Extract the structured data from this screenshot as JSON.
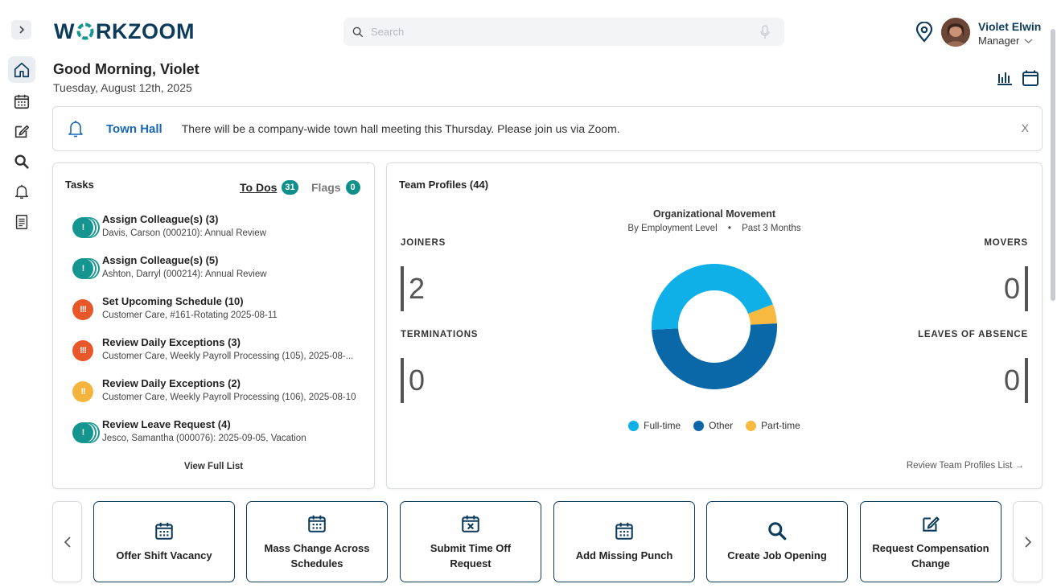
{
  "app": {
    "logo_left": "W",
    "logo_right": "RKZOOM",
    "brand_color": "#0c3b5c",
    "accent_teal": "#14958f"
  },
  "search": {
    "placeholder": "Search"
  },
  "user": {
    "name": "Violet Elwin",
    "role": "Manager"
  },
  "greeting": {
    "title": "Good Morning, Violet",
    "date": "Tuesday, August 12th, 2025"
  },
  "announcement": {
    "title": "Town Hall",
    "message": "There will be a company-wide town hall meeting this Thursday. Please join us via Zoom.",
    "close": "X"
  },
  "tasks": {
    "title": "Tasks",
    "tabs": [
      {
        "label": "To Dos",
        "count": "31"
      },
      {
        "label": "Flags",
        "count": "0"
      }
    ],
    "items": [
      {
        "title": "Assign Colleague(s) (3)",
        "sub": "Davis, Carson (000210): Annual Review",
        "priority": "!",
        "color": "teal"
      },
      {
        "title": "Assign Colleague(s) (5)",
        "sub": "Ashton, Darryl (000214): Annual Review",
        "priority": "!",
        "color": "teal"
      },
      {
        "title": "Set Upcoming Schedule (10)",
        "sub": "Customer Care, #161-Rotating 2025-08-11",
        "priority": "!!!",
        "color": "red"
      },
      {
        "title": "Review Daily Exceptions (3)",
        "sub": "Customer Care, Weekly Payroll Processing (105), 2025-08-...",
        "priority": "!!!",
        "color": "red"
      },
      {
        "title": "Review Daily Exceptions (2)",
        "sub": "Customer Care, Weekly Payroll Processing (106), 2025-08-10",
        "priority": "!!",
        "color": "amber"
      },
      {
        "title": "Review Leave Request (4)",
        "sub": "Jesco, Samantha (000076): 2025-09-05, Vacation",
        "priority": "!",
        "color": "teal"
      }
    ],
    "view_full": "View Full List"
  },
  "team": {
    "title": "Team Profiles (44)",
    "chart_title": "Organizational Movement",
    "chart_sub_a": "By Employment Level",
    "chart_sub_sep": "•",
    "chart_sub_b": "Past 3 Months",
    "stats": {
      "joiners_label": "JOINERS",
      "joiners": "2",
      "terminations_label": "TERMINATIONS",
      "terminations": "0",
      "movers_label": "MOVERS",
      "movers": "0",
      "loa_label": "LEAVES OF ABSENCE",
      "loa": "0"
    },
    "review_link": "Review Team Profiles List →"
  },
  "chart_data": {
    "type": "pie",
    "donut": true,
    "categories": [
      "Full-time",
      "Other",
      "Part-time"
    ],
    "values": [
      45,
      50,
      5
    ],
    "colors": [
      "#0fb0e8",
      "#0a67a8",
      "#f7b940"
    ],
    "title": "Organizational Movement",
    "legend_position": "bottom"
  },
  "quick_actions": [
    {
      "label": "Offer Shift Vacancy",
      "icon": "calendar-icon"
    },
    {
      "label": "Mass Change Across Schedules",
      "icon": "calendar-icon"
    },
    {
      "label": "Submit Time Off Request",
      "icon": "calendar-x-icon"
    },
    {
      "label": "Add Missing Punch",
      "icon": "calendar-icon"
    },
    {
      "label": "Create Job Opening",
      "icon": "search-icon"
    },
    {
      "label": "Request Compensation Change",
      "icon": "edit-icon"
    }
  ]
}
